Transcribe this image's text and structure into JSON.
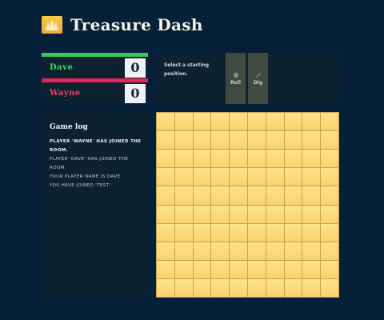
{
  "app": {
    "title": "Treasure Dash",
    "logo_icon": "treasure-logo-icon"
  },
  "players": [
    {
      "name": "Dave",
      "score": "0",
      "color": "#34c759"
    },
    {
      "name": "Wayne",
      "score": "0",
      "color": "#e0265a"
    }
  ],
  "action": {
    "prompt": "Select a starting position.",
    "buttons": [
      {
        "label": "Roll",
        "icon": "dice-icon"
      },
      {
        "label": "Dig",
        "icon": "shovel-icon"
      }
    ]
  },
  "log": {
    "title": "Game log",
    "entries": [
      "Player 'Wayne' has joined the room.",
      "Player 'Dave' has joined the room.",
      "Your player name is Dave",
      "You have joined 'test'"
    ]
  },
  "board": {
    "rows": 10,
    "cols": 10,
    "cell_color": "#f8d36e"
  },
  "colors": {
    "background": "#06203a",
    "panel": "#0d2230",
    "button": "#414a40"
  }
}
